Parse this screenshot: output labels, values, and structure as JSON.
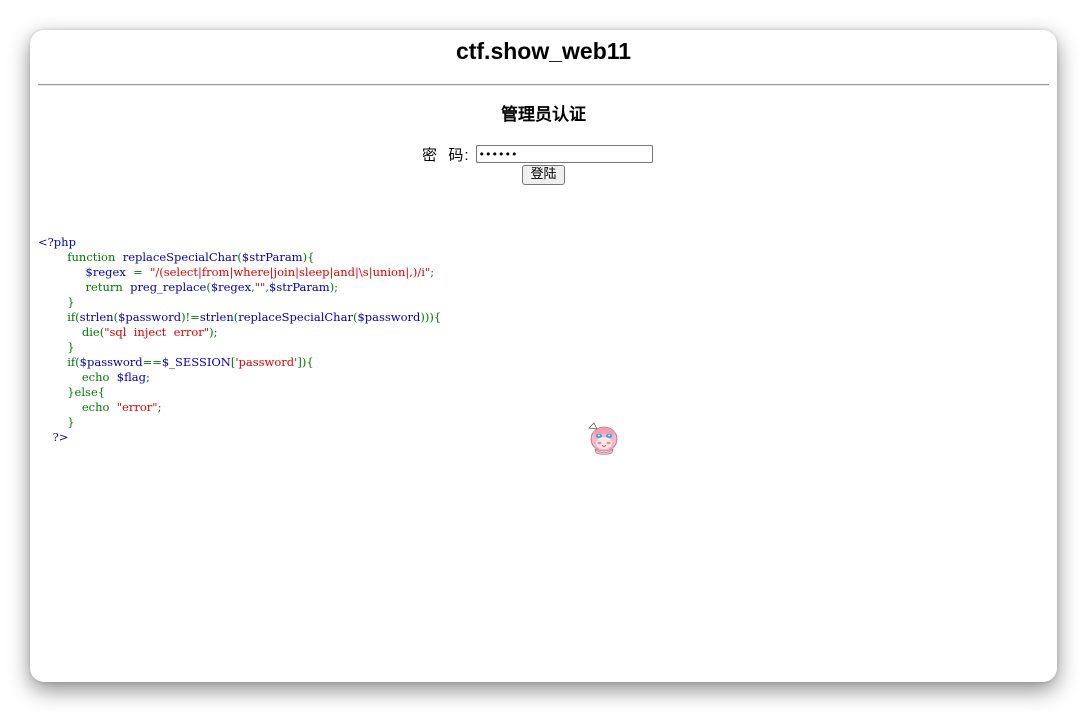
{
  "page": {
    "site_title": "ctf.show_web11",
    "auth_title": "管理员认证",
    "password_label": "密  码:",
    "password_value": "••••••",
    "login_label": "登陆"
  },
  "code": {
    "open_tag": "<?php",
    "lines": [
      [
        {
          "t": "        function  ",
          "c": "kw"
        },
        {
          "t": "replaceSpecialChar",
          "c": "var"
        },
        {
          "t": "(",
          "c": "kw"
        },
        {
          "t": "$strParam",
          "c": "var"
        },
        {
          "t": "){",
          "c": "kw"
        }
      ],
      [
        {
          "t": "             ",
          "c": "kw"
        },
        {
          "t": "$regex  ",
          "c": "var"
        },
        {
          "t": "=  ",
          "c": "kw"
        },
        {
          "t": "\"/(select|from|where|join|sleep|and|\\s|union|,)/i\"",
          "c": "str"
        },
        {
          "t": ";",
          "c": "kw"
        }
      ],
      [
        {
          "t": "             return  ",
          "c": "kw"
        },
        {
          "t": "preg_replace",
          "c": "var"
        },
        {
          "t": "(",
          "c": "kw"
        },
        {
          "t": "$regex",
          "c": "var"
        },
        {
          "t": ",",
          "c": "kw"
        },
        {
          "t": "\"\"",
          "c": "str"
        },
        {
          "t": ",",
          "c": "kw"
        },
        {
          "t": "$strParam",
          "c": "var"
        },
        {
          "t": ");",
          "c": "kw"
        }
      ],
      [
        {
          "t": "        }",
          "c": "kw"
        }
      ],
      [
        {
          "t": "        if(",
          "c": "kw"
        },
        {
          "t": "strlen",
          "c": "var"
        },
        {
          "t": "(",
          "c": "kw"
        },
        {
          "t": "$password",
          "c": "var"
        },
        {
          "t": ")!=",
          "c": "kw"
        },
        {
          "t": "strlen",
          "c": "var"
        },
        {
          "t": "(",
          "c": "kw"
        },
        {
          "t": "replaceSpecialChar",
          "c": "var"
        },
        {
          "t": "(",
          "c": "kw"
        },
        {
          "t": "$password",
          "c": "var"
        },
        {
          "t": "))){",
          "c": "kw"
        }
      ],
      [
        {
          "t": "            die(",
          "c": "kw"
        },
        {
          "t": "\"sql  inject  error\"",
          "c": "str"
        },
        {
          "t": ");",
          "c": "kw"
        }
      ],
      [
        {
          "t": "        }",
          "c": "kw"
        }
      ],
      [
        {
          "t": "        if(",
          "c": "kw"
        },
        {
          "t": "$password",
          "c": "var"
        },
        {
          "t": "==",
          "c": "kw"
        },
        {
          "t": "$_SESSION",
          "c": "var"
        },
        {
          "t": "[",
          "c": "kw"
        },
        {
          "t": "'password'",
          "c": "str"
        },
        {
          "t": "]){",
          "c": "kw"
        }
      ],
      [
        {
          "t": "            echo  ",
          "c": "kw"
        },
        {
          "t": "$flag",
          "c": "var"
        },
        {
          "t": ";",
          "c": "kw"
        }
      ],
      [
        {
          "t": "        }else{",
          "c": "kw"
        }
      ],
      [
        {
          "t": "            echo  ",
          "c": "kw"
        },
        {
          "t": "\"error\"",
          "c": "str"
        },
        {
          "t": ";",
          "c": "kw"
        }
      ],
      [
        {
          "t": "        }",
          "c": "kw"
        }
      ],
      [
        {
          "t": "    ?>",
          "c": "php"
        }
      ]
    ]
  },
  "colors": {
    "php_default": "#0000bb",
    "keyword": "#007700",
    "string": "#dd0000"
  },
  "icons": {
    "mascot": "anime-mascot-icon"
  }
}
